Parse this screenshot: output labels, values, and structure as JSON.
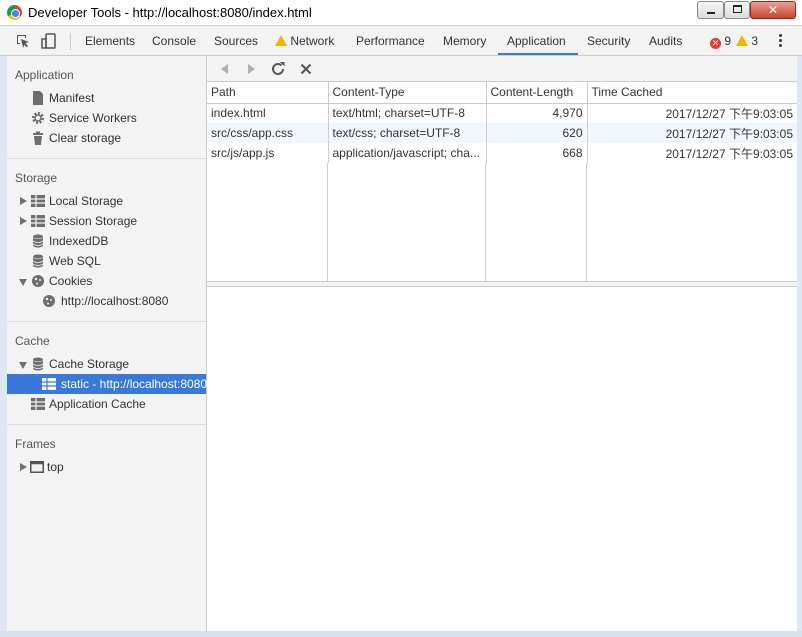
{
  "window": {
    "title": "Developer Tools - http://localhost:8080/index.html"
  },
  "toolbar": {
    "tabs": [
      "Elements",
      "Console",
      "Sources",
      "Network",
      "Performance",
      "Memory",
      "Application",
      "Security",
      "Audits"
    ],
    "active_tab": "Application",
    "error_count": "9",
    "warning_count": "3"
  },
  "sidebar": {
    "application": {
      "title": "Application",
      "items": [
        "Manifest",
        "Service Workers",
        "Clear storage"
      ]
    },
    "storage": {
      "title": "Storage",
      "items": [
        "Local Storage",
        "Session Storage",
        "IndexedDB",
        "Web SQL",
        "Cookies"
      ],
      "cookie_origin": "http://localhost:8080"
    },
    "cache": {
      "title": "Cache",
      "items": [
        "Cache Storage",
        "Application Cache"
      ],
      "cache_entry": "static - http://localhost:8080"
    },
    "frames": {
      "title": "Frames",
      "items": [
        "top"
      ]
    }
  },
  "table": {
    "headers": [
      "Path",
      "Content-Type",
      "Content-Length",
      "Time Cached"
    ],
    "rows": [
      [
        "index.html",
        "text/html; charset=UTF-8",
        "4,970",
        "2017/12/27 下午9:03:05"
      ],
      [
        "src/css/app.css",
        "text/css; charset=UTF-8",
        "620",
        "2017/12/27 下午9:03:05"
      ],
      [
        "src/js/app.js",
        "application/javascript; cha...",
        "668",
        "2017/12/27 下午9:03:05"
      ]
    ]
  },
  "colors": {
    "accent": "#3879d9",
    "selected_bg": "#3879d9",
    "error": "#e53935",
    "warning": "#f4b400"
  }
}
